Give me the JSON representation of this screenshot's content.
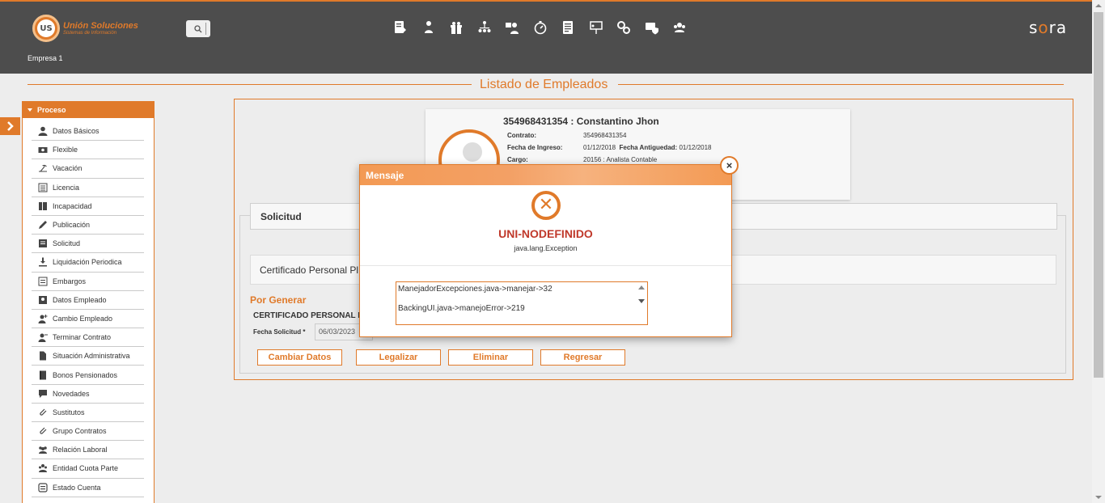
{
  "header": {
    "logo_title": "Unión Soluciones",
    "logo_subtitle": "Sistemas de Información",
    "logo_mark": "US",
    "empresa": "Empresa 1",
    "brand_left": "s",
    "brand_o": "o",
    "brand_right": "ra",
    "top_icons": [
      "document-edit-icon",
      "user-hierarchy-icon",
      "gift-icon",
      "org-chart-icon",
      "people-transfer-icon",
      "stopwatch-icon",
      "report-icon",
      "presentation-icon",
      "settings-gears-icon",
      "shield-badge-icon",
      "group-icon"
    ]
  },
  "page_title": "Listado de Empleados",
  "sidebar": {
    "section": "Proceso",
    "items": [
      {
        "label": "Datos Básicos",
        "icon": "user-icon"
      },
      {
        "label": "Flexible",
        "icon": "money-icon"
      },
      {
        "label": "Vacación",
        "icon": "beach-icon"
      },
      {
        "label": "Licencia",
        "icon": "list-icon"
      },
      {
        "label": "Incapacidad",
        "icon": "medical-icon"
      },
      {
        "label": "Publicación",
        "icon": "pencil-icon"
      },
      {
        "label": "Solicitud",
        "icon": "form-icon"
      },
      {
        "label": "Liquidación Periodica",
        "icon": "download-icon"
      },
      {
        "label": "Embargos",
        "icon": "list-box-icon"
      },
      {
        "label": "Datos Empleado",
        "icon": "id-card-icon"
      },
      {
        "label": "Cambio Empleado",
        "icon": "user-plus-icon"
      },
      {
        "label": "Terminar Contrato",
        "icon": "user-x-icon"
      },
      {
        "label": "Situación Administrativa",
        "icon": "doc-icon"
      },
      {
        "label": "Bonos Pensionados",
        "icon": "book-icon"
      },
      {
        "label": "Novedades",
        "icon": "chat-icon"
      },
      {
        "label": "Sustitutos",
        "icon": "paperclip-icon"
      },
      {
        "label": "Grupo Contratos",
        "icon": "paperclip-icon"
      },
      {
        "label": "Relación Laboral",
        "icon": "team-icon"
      },
      {
        "label": "Entidad Cuota Parte",
        "icon": "group-icon"
      },
      {
        "label": "Estado Cuenta",
        "icon": "account-icon"
      }
    ]
  },
  "employee": {
    "name": "354968431354 : Constantino Jhon",
    "contrato_label": "Contrato:",
    "contrato": "354968431354",
    "ingreso_label": "Fecha de Ingreso:",
    "ingreso": "01/12/2018",
    "antiguedad_label": "Fecha Antiguedad:",
    "antiguedad": "01/12/2018",
    "cargo_label": "Cargo:",
    "cargo": "20156 : Analista Contable"
  },
  "solicitud": {
    "tab": "Solicitud",
    "cert_bar": "Certificado Personal Pl",
    "por_generar": "Por Generar",
    "cert_label": "CERTIFICADO PERSONAL P",
    "fecha_label": "Fecha Solicitud",
    "fecha_required": "*",
    "fecha_value": "06/03/2023"
  },
  "buttons": {
    "cambiar": "Cambiar Datos",
    "legalizar": "Legalizar",
    "eliminar": "Eliminar",
    "regresar": "Regresar"
  },
  "dialog": {
    "title": "Mensaje",
    "close": "×",
    "error_title": "UNI-NODEFINIDO",
    "error_sub": "java.lang.Exception",
    "trace_1": "ManejadorExcepciones.java->manejar->32",
    "trace_2": "BackingUI.java->manejoError->219"
  },
  "colors": {
    "accent": "#e07a2a",
    "topbar": "#4d4d4d",
    "error": "#c0392b"
  }
}
